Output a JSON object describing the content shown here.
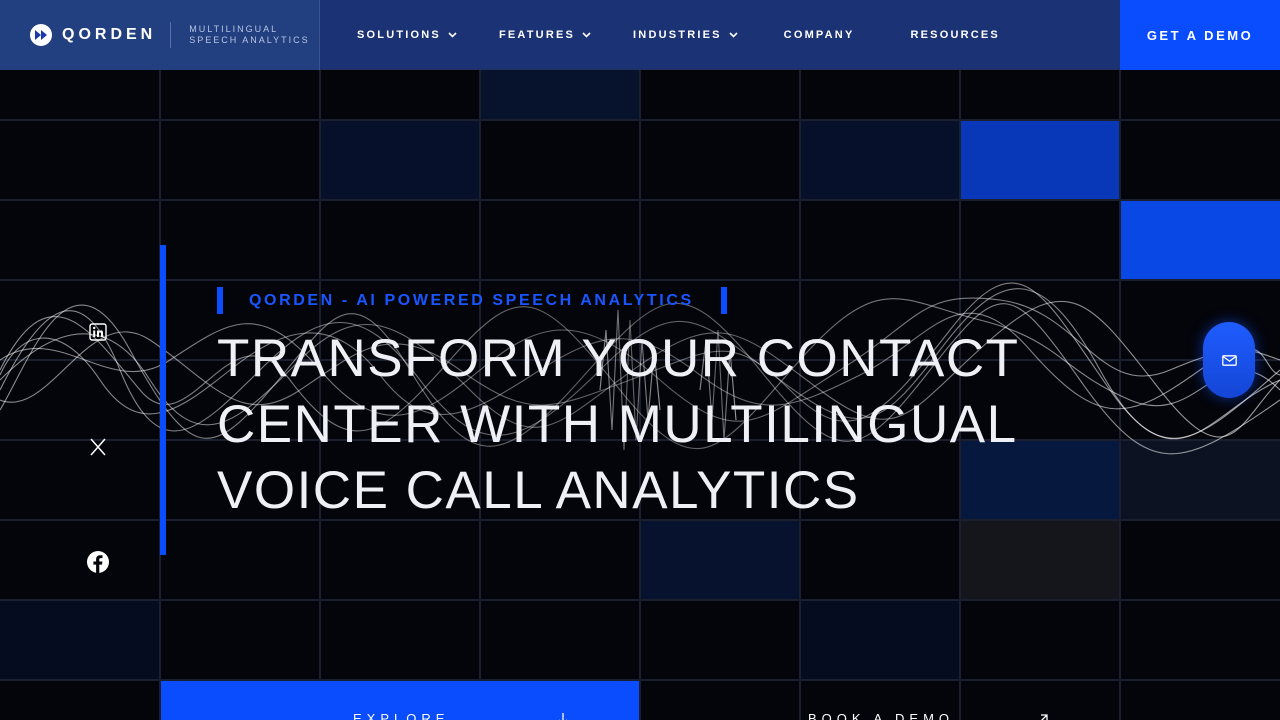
{
  "brand": {
    "name": "QORDEN",
    "tagline_line1": "MULTILINGUAL",
    "tagline_line2": "SPEECH ANALYTICS"
  },
  "nav": {
    "items": [
      {
        "label": "SOLUTIONS",
        "has_dropdown": true
      },
      {
        "label": "FEATURES",
        "has_dropdown": true
      },
      {
        "label": "INDUSTRIES",
        "has_dropdown": true
      },
      {
        "label": "COMPANY",
        "has_dropdown": false
      },
      {
        "label": "RESOURCES",
        "has_dropdown": false
      }
    ],
    "cta_label": "GET A DEMO"
  },
  "social": [
    {
      "icon": "linkedin-icon"
    },
    {
      "icon": "x-icon"
    },
    {
      "icon": "facebook-icon"
    }
  ],
  "hero": {
    "eyebrow": "QORDEN - AI POWERED SPEECH ANALYTICS",
    "headline_line1": "TRANSFORM  YOUR  CONTACT",
    "headline_line2": "CENTER  WITH MULTILINGUAL",
    "headline_line3": "VOICE CALL ANALYTICS"
  },
  "buttons": {
    "explore_label": "EXPLORE",
    "book_label": "BOOK A DEMO"
  },
  "floating": {
    "icon": "mail-icon"
  },
  "colors": {
    "accent": "#0A4DFF",
    "header_bg": "#1B3375",
    "background": "#04050A",
    "headline_text": "#EEF0F5"
  }
}
